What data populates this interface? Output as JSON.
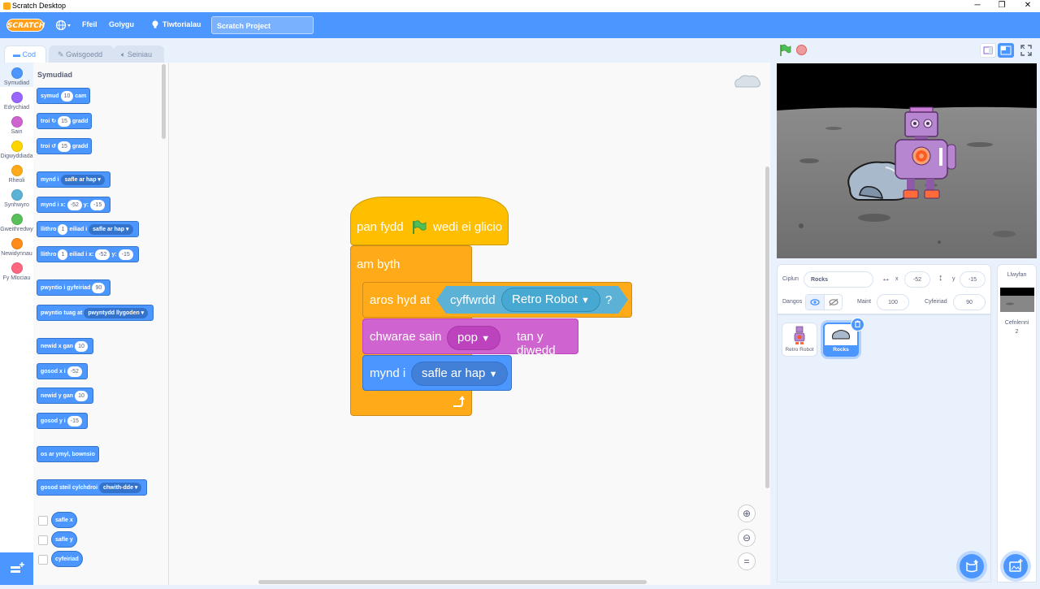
{
  "window": {
    "title": "Scratch Desktop",
    "controls": {
      "minimize": "─",
      "maximize": "❐",
      "close": "✕"
    }
  },
  "menubar": {
    "logo": "SCRATCH",
    "items": {
      "file": "Ffeil",
      "edit": "Golygu",
      "tutorials": "Tiwtorialau"
    },
    "project_title": "Scratch Project"
  },
  "tabs": {
    "code": "Cod",
    "costumes": "Gwisgoedd",
    "sounds": "Seiniau"
  },
  "categories": [
    {
      "label": "Symudiad",
      "color": "#4c97ff"
    },
    {
      "label": "Edrychiad",
      "color": "#9966ff"
    },
    {
      "label": "Sain",
      "color": "#cf63cf"
    },
    {
      "label": "Digwyddiada",
      "color": "#ffd500"
    },
    {
      "label": "Rheoli",
      "color": "#ffab19"
    },
    {
      "label": "Synhwyro",
      "color": "#5cb1d6"
    },
    {
      "label": "Gweithredwy",
      "color": "#59c059"
    },
    {
      "label": "Newidynnau",
      "color": "#ff8c1a"
    },
    {
      "label": "Fy Mlociau",
      "color": "#ff6680"
    }
  ],
  "palette": {
    "heading": "Symudiad",
    "move": {
      "a": "symud",
      "v": "10",
      "b": "cam"
    },
    "turn_right": {
      "a": "troi",
      "v": "15",
      "b": "gradd"
    },
    "turn_left": {
      "a": "troi",
      "v": "15",
      "b": "gradd"
    },
    "goto": {
      "a": "mynd i",
      "d": "safle ar hap"
    },
    "goto_xy": {
      "a": "mynd i x:",
      "x": "-52",
      "b": "y:",
      "y": "-15"
    },
    "glide": {
      "a": "llithro",
      "v": "1",
      "b": "eiliad i",
      "d": "safle ar hap"
    },
    "glide_xy": {
      "a": "llithro",
      "v": "1",
      "b": "eiliad i x:",
      "x": "-52",
      "c": "y:",
      "y": "-15"
    },
    "point_dir": {
      "a": "pwyntio i gyfeiriad",
      "v": "90"
    },
    "point_towards": {
      "a": "pwyntio tuag at",
      "d": "pwyntydd llygoden"
    },
    "change_x": {
      "a": "newid x gan",
      "v": "10"
    },
    "set_x": {
      "a": "gosod x i",
      "v": "-52"
    },
    "change_y": {
      "a": "newid y gan",
      "v": "10"
    },
    "set_y": {
      "a": "gosod y i",
      "v": "-15"
    },
    "bounce": "os ar ymyl, bownsio",
    "rotation": {
      "a": "gosod steil cylchdroi",
      "d": "chwith-dde"
    },
    "reporters": [
      "safle x",
      "safle y",
      "cyfeiriad"
    ]
  },
  "script": {
    "hat": {
      "a": "pan fydd",
      "b": "wedi ei glicio"
    },
    "forever": "am byth",
    "wait_until": {
      "a": "aros hyd at",
      "sense": "cyffwrdd",
      "target": "Retro Robot",
      "q": "?"
    },
    "play_sound": {
      "a": "chwarae sain",
      "sound": "pop",
      "b": "tan y diwedd"
    },
    "go_to": {
      "a": "mynd i",
      "target": "safle ar hap"
    }
  },
  "sprite_info": {
    "sprite_label": "Ciplun",
    "sprite_name": "Rocks",
    "x_label": "x",
    "x": "-52",
    "y_label": "y",
    "y": "-15",
    "show_label": "Dangos",
    "size_label": "Maint",
    "size": "100",
    "direction_label": "Cyfeiriad",
    "direction": "90"
  },
  "sprites": [
    {
      "name": "Retro Robot",
      "selected": false
    },
    {
      "name": "Rocks",
      "selected": true
    }
  ],
  "stage_pane": {
    "title": "Llwyfan",
    "backdrops_label": "Cefnlenni",
    "backdrops_count": "2"
  }
}
